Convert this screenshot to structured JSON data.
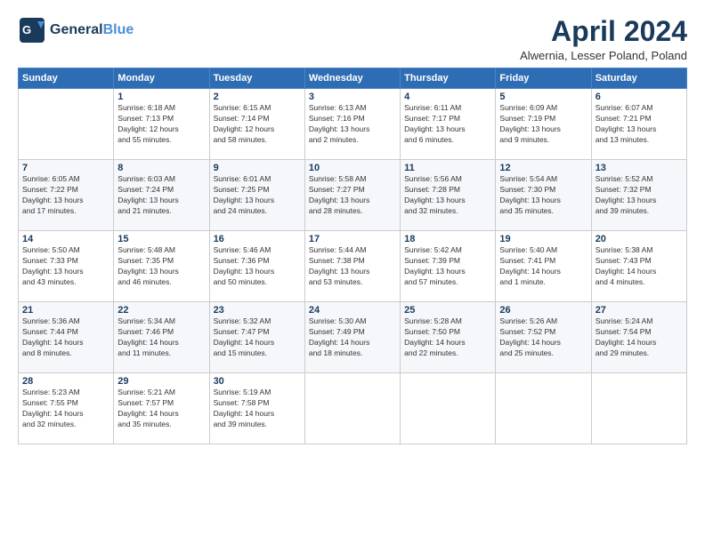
{
  "header": {
    "logo_line1": "General",
    "logo_line2": "Blue",
    "title": "April 2024",
    "subtitle": "Alwernia, Lesser Poland, Poland"
  },
  "days_of_week": [
    "Sunday",
    "Monday",
    "Tuesday",
    "Wednesday",
    "Thursday",
    "Friday",
    "Saturday"
  ],
  "weeks": [
    [
      {
        "day": "",
        "info": ""
      },
      {
        "day": "1",
        "info": "Sunrise: 6:18 AM\nSunset: 7:13 PM\nDaylight: 12 hours\nand 55 minutes."
      },
      {
        "day": "2",
        "info": "Sunrise: 6:15 AM\nSunset: 7:14 PM\nDaylight: 12 hours\nand 58 minutes."
      },
      {
        "day": "3",
        "info": "Sunrise: 6:13 AM\nSunset: 7:16 PM\nDaylight: 13 hours\nand 2 minutes."
      },
      {
        "day": "4",
        "info": "Sunrise: 6:11 AM\nSunset: 7:17 PM\nDaylight: 13 hours\nand 6 minutes."
      },
      {
        "day": "5",
        "info": "Sunrise: 6:09 AM\nSunset: 7:19 PM\nDaylight: 13 hours\nand 9 minutes."
      },
      {
        "day": "6",
        "info": "Sunrise: 6:07 AM\nSunset: 7:21 PM\nDaylight: 13 hours\nand 13 minutes."
      }
    ],
    [
      {
        "day": "7",
        "info": "Sunrise: 6:05 AM\nSunset: 7:22 PM\nDaylight: 13 hours\nand 17 minutes."
      },
      {
        "day": "8",
        "info": "Sunrise: 6:03 AM\nSunset: 7:24 PM\nDaylight: 13 hours\nand 21 minutes."
      },
      {
        "day": "9",
        "info": "Sunrise: 6:01 AM\nSunset: 7:25 PM\nDaylight: 13 hours\nand 24 minutes."
      },
      {
        "day": "10",
        "info": "Sunrise: 5:58 AM\nSunset: 7:27 PM\nDaylight: 13 hours\nand 28 minutes."
      },
      {
        "day": "11",
        "info": "Sunrise: 5:56 AM\nSunset: 7:28 PM\nDaylight: 13 hours\nand 32 minutes."
      },
      {
        "day": "12",
        "info": "Sunrise: 5:54 AM\nSunset: 7:30 PM\nDaylight: 13 hours\nand 35 minutes."
      },
      {
        "day": "13",
        "info": "Sunrise: 5:52 AM\nSunset: 7:32 PM\nDaylight: 13 hours\nand 39 minutes."
      }
    ],
    [
      {
        "day": "14",
        "info": "Sunrise: 5:50 AM\nSunset: 7:33 PM\nDaylight: 13 hours\nand 43 minutes."
      },
      {
        "day": "15",
        "info": "Sunrise: 5:48 AM\nSunset: 7:35 PM\nDaylight: 13 hours\nand 46 minutes."
      },
      {
        "day": "16",
        "info": "Sunrise: 5:46 AM\nSunset: 7:36 PM\nDaylight: 13 hours\nand 50 minutes."
      },
      {
        "day": "17",
        "info": "Sunrise: 5:44 AM\nSunset: 7:38 PM\nDaylight: 13 hours\nand 53 minutes."
      },
      {
        "day": "18",
        "info": "Sunrise: 5:42 AM\nSunset: 7:39 PM\nDaylight: 13 hours\nand 57 minutes."
      },
      {
        "day": "19",
        "info": "Sunrise: 5:40 AM\nSunset: 7:41 PM\nDaylight: 14 hours\nand 1 minute."
      },
      {
        "day": "20",
        "info": "Sunrise: 5:38 AM\nSunset: 7:43 PM\nDaylight: 14 hours\nand 4 minutes."
      }
    ],
    [
      {
        "day": "21",
        "info": "Sunrise: 5:36 AM\nSunset: 7:44 PM\nDaylight: 14 hours\nand 8 minutes."
      },
      {
        "day": "22",
        "info": "Sunrise: 5:34 AM\nSunset: 7:46 PM\nDaylight: 14 hours\nand 11 minutes."
      },
      {
        "day": "23",
        "info": "Sunrise: 5:32 AM\nSunset: 7:47 PM\nDaylight: 14 hours\nand 15 minutes."
      },
      {
        "day": "24",
        "info": "Sunrise: 5:30 AM\nSunset: 7:49 PM\nDaylight: 14 hours\nand 18 minutes."
      },
      {
        "day": "25",
        "info": "Sunrise: 5:28 AM\nSunset: 7:50 PM\nDaylight: 14 hours\nand 22 minutes."
      },
      {
        "day": "26",
        "info": "Sunrise: 5:26 AM\nSunset: 7:52 PM\nDaylight: 14 hours\nand 25 minutes."
      },
      {
        "day": "27",
        "info": "Sunrise: 5:24 AM\nSunset: 7:54 PM\nDaylight: 14 hours\nand 29 minutes."
      }
    ],
    [
      {
        "day": "28",
        "info": "Sunrise: 5:23 AM\nSunset: 7:55 PM\nDaylight: 14 hours\nand 32 minutes."
      },
      {
        "day": "29",
        "info": "Sunrise: 5:21 AM\nSunset: 7:57 PM\nDaylight: 14 hours\nand 35 minutes."
      },
      {
        "day": "30",
        "info": "Sunrise: 5:19 AM\nSunset: 7:58 PM\nDaylight: 14 hours\nand 39 minutes."
      },
      {
        "day": "",
        "info": ""
      },
      {
        "day": "",
        "info": ""
      },
      {
        "day": "",
        "info": ""
      },
      {
        "day": "",
        "info": ""
      }
    ]
  ]
}
